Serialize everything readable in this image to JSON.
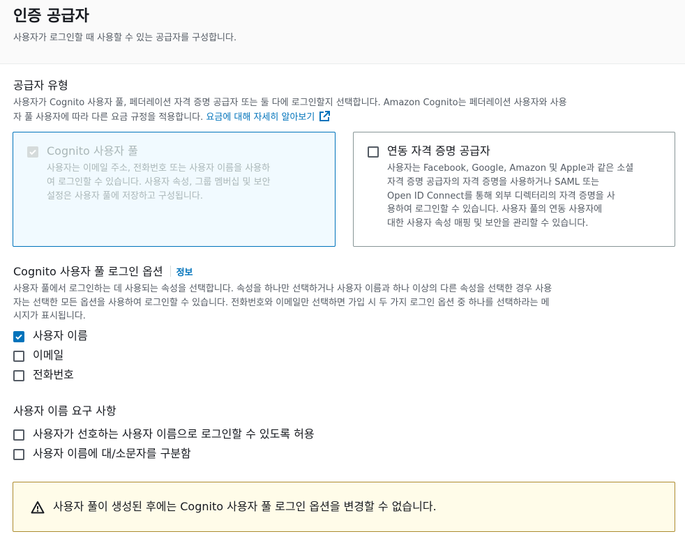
{
  "header": {
    "title": "인증 공급자",
    "subtitle": "사용자가 로그인할 때 사용할 수 있는 공급자를 구성합니다."
  },
  "provider_type": {
    "title": "공급자 유형",
    "description_line1": "사용자가 Cognito 사용자 풀, 페더레이션 자격 증명 공급자 또는 둘 다에 로그인할지 선택합니다. Amazon Cognito는 페더레이션 사용자와 사용",
    "description_line2": "자 풀 사용자에 따라 다른 요금 규정을 적용합니다. ",
    "pricing_link": "요금에 대해 자세히 알아보기",
    "tiles": [
      {
        "title": "Cognito 사용자 풀",
        "desc_lines": [
          "사용자는 이메일 주소, 전화번호 또는 사용자 이름을 사용하",
          "여 로그인할 수 있습니다. 사용자 속성, 그룹 멤버십 및 보안",
          "설정은 사용자 풀에 저장하고 구성됩니다."
        ],
        "checked": true,
        "disabled": true
      },
      {
        "title": "연동 자격 증명 공급자",
        "desc_lines": [
          "사용자는 Facebook, Google, Amazon 및 Apple과 같은 소셜",
          "자격 증명 공급자의 자격 증명을 사용하거나 SAML 또는",
          "Open ID Connect를 통해 외부 디렉터리의 자격 증명을 사",
          "용하여 로그인할 수 있습니다. 사용자 풀의 연동 사용자에",
          "대한 사용자 속성 매핑 및 보안을 관리할 수 있습니다."
        ],
        "checked": false,
        "disabled": false
      }
    ]
  },
  "signin_options": {
    "title": "Cognito 사용자 풀 로그인 옵션",
    "info_label": "정보",
    "desc_lines": [
      "사용자 풀에서 로그인하는 데 사용되는 속성을 선택합니다. 속성을 하나만 선택하거나 사용자 이름과 하나 이상의 다른 속성을 선택한 경우 사용",
      "자는 선택한 모든 옵션을 사용하여 로그인할 수 있습니다. 전화번호와 이메일만 선택하면 가입 시 두 가지 로그인 옵션 중 하나를 선택하라는 메",
      "시지가 표시됩니다."
    ],
    "options": [
      {
        "label": "사용자 이름",
        "checked": true
      },
      {
        "label": "이메일",
        "checked": false
      },
      {
        "label": "전화번호",
        "checked": false
      }
    ]
  },
  "username_requirements": {
    "title": "사용자 이름 요구 사항",
    "options": [
      {
        "label": "사용자가 선호하는 사용자 이름으로 로그인할 수 있도록 허용",
        "checked": false
      },
      {
        "label": "사용자 이름에 대/소문자를 구분함",
        "checked": false
      }
    ]
  },
  "alert": {
    "icon": "warning-icon",
    "text": "사용자 풀이 생성된 후에는 Cognito 사용자 풀 로그인 옵션을 변경할 수 없습니다."
  },
  "colors": {
    "link": "#0073bb",
    "selected_border": "#0073bb",
    "selected_bg": "#f1faff",
    "warning_bg": "#fffce9",
    "warning_border": "#ac8b2f"
  }
}
